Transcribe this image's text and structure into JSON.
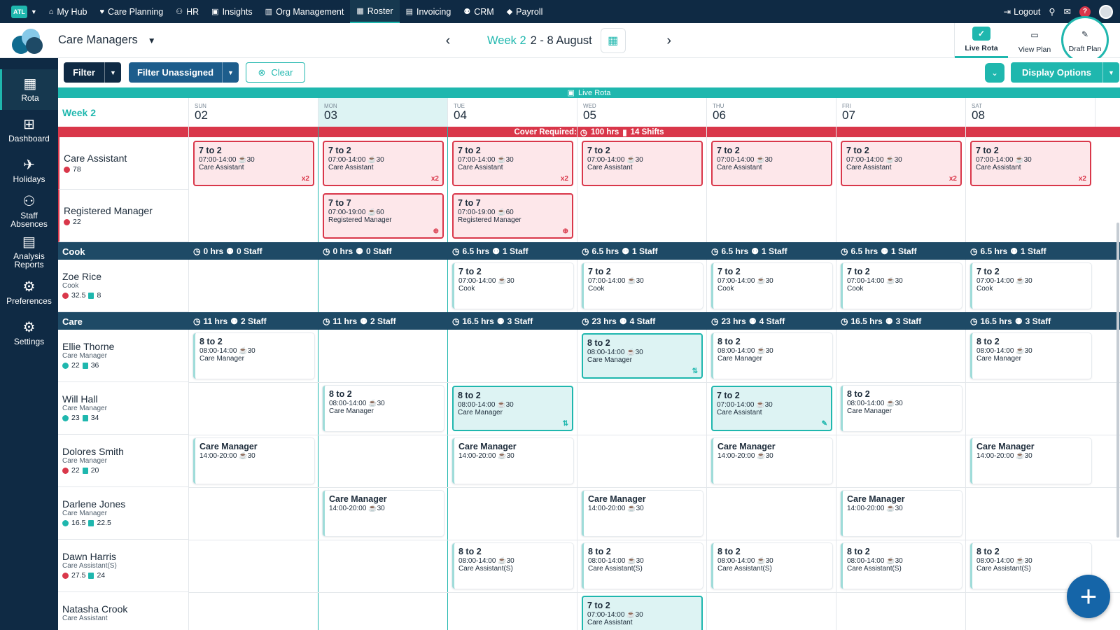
{
  "topnav": {
    "org_badge": "ATL",
    "items": [
      {
        "icon": "home-icon",
        "glyph": "⌂",
        "label": "My Hub"
      },
      {
        "icon": "heart-icon",
        "glyph": "♥",
        "label": "Care Planning"
      },
      {
        "icon": "people-icon",
        "glyph": "⚇",
        "label": "HR"
      },
      {
        "icon": "chart-icon",
        "glyph": "▣",
        "label": "Insights"
      },
      {
        "icon": "building-icon",
        "glyph": "▥",
        "label": "Org Management"
      },
      {
        "icon": "calendar-icon",
        "glyph": "▦",
        "label": "Roster"
      },
      {
        "icon": "document-icon",
        "glyph": "▤",
        "label": "Invoicing"
      },
      {
        "icon": "contacts-icon",
        "glyph": "⚉",
        "label": "CRM"
      },
      {
        "icon": "tag-icon",
        "glyph": "◆",
        "label": "Payroll"
      }
    ],
    "active": "Roster",
    "logout": "Logout",
    "help": "?"
  },
  "header": {
    "page_select": "Care Managers",
    "week_label": "Week 2",
    "week_range": "2 - 8 August",
    "tabs": [
      "Live Rota",
      "View Plan",
      "Draft Plan"
    ]
  },
  "sidebar": [
    {
      "label": "Rota",
      "icon": "rota-icon",
      "glyph": "▦"
    },
    {
      "label": "Dashboard",
      "icon": "dashboard-icon",
      "glyph": "⊞"
    },
    {
      "label": "Holidays",
      "icon": "holidays-icon",
      "glyph": "✈"
    },
    {
      "label": "Staff Absences",
      "icon": "staff-absences-icon",
      "glyph": "⚇"
    },
    {
      "label": "Analysis Reports",
      "icon": "analysis-reports-icon",
      "glyph": "▤"
    },
    {
      "label": "Preferences",
      "icon": "preferences-icon",
      "glyph": "⚙"
    },
    {
      "label": "Settings",
      "icon": "settings-icon",
      "glyph": "⚙"
    }
  ],
  "filters": {
    "filter": "Filter",
    "filter_unassigned": "Filter Unassigned",
    "clear": "Clear",
    "display_options": "Display Options"
  },
  "banner": "Live Rota",
  "week_title": "Week 2",
  "days": [
    {
      "dow": "SUN",
      "date": "02"
    },
    {
      "dow": "MON",
      "date": "03"
    },
    {
      "dow": "TUE",
      "date": "04"
    },
    {
      "dow": "WED",
      "date": "05"
    },
    {
      "dow": "THU",
      "date": "06"
    },
    {
      "dow": "FRI",
      "date": "07"
    },
    {
      "dow": "SAT",
      "date": "08"
    }
  ],
  "cover": {
    "label": "Cover Required:",
    "hours": "100 hrs",
    "shifts": "14 Shifts"
  },
  "cover_rows": [
    {
      "name": "Care Assistant",
      "count": "78",
      "shifts": [
        {
          "title": "7 to 2",
          "hours": "07:00-14:00",
          "brk": "30",
          "role": "Care Assistant",
          "corner": "x2"
        },
        {
          "title": "7 to 2",
          "hours": "07:00-14:00",
          "brk": "30",
          "role": "Care Assistant",
          "corner": "x2"
        },
        {
          "title": "7 to 2",
          "hours": "07:00-14:00",
          "brk": "30",
          "role": "Care Assistant",
          "corner": "x2"
        },
        {
          "title": "7 to 2",
          "hours": "07:00-14:00",
          "brk": "30",
          "role": "Care Assistant",
          "corner": ""
        },
        {
          "title": "7 to 2",
          "hours": "07:00-14:00",
          "brk": "30",
          "role": "Care Assistant",
          "corner": ""
        },
        {
          "title": "7 to 2",
          "hours": "07:00-14:00",
          "brk": "30",
          "role": "Care Assistant",
          "corner": "x2"
        },
        {
          "title": "7 to 2",
          "hours": "07:00-14:00",
          "brk": "30",
          "role": "Care Assistant",
          "corner": "x2"
        }
      ]
    },
    {
      "name": "Registered Manager",
      "count": "22",
      "shifts": [
        null,
        {
          "title": "7 to 7",
          "hours": "07:00-19:00",
          "brk": "60",
          "role": "Registered Manager",
          "corner": "⊕"
        },
        {
          "title": "7 to 7",
          "hours": "07:00-19:00",
          "brk": "60",
          "role": "Registered Manager",
          "corner": "⊕"
        },
        null,
        null,
        null,
        null
      ]
    }
  ],
  "sections": [
    {
      "name": "Cook",
      "stats": [
        {
          "hrs": "0 hrs",
          "staff": "0 Staff"
        },
        {
          "hrs": "0 hrs",
          "staff": "0 Staff"
        },
        {
          "hrs": "6.5 hrs",
          "staff": "1 Staff"
        },
        {
          "hrs": "6.5 hrs",
          "staff": "1 Staff"
        },
        {
          "hrs": "6.5 hrs",
          "staff": "1 Staff"
        },
        {
          "hrs": "6.5 hrs",
          "staff": "1 Staff"
        },
        {
          "hrs": "6.5 hrs",
          "staff": "1 Staff"
        }
      ],
      "staff": [
        {
          "name": "Zoe Rice",
          "role": "Cook",
          "stat1": "32.5",
          "stat1_color": "red",
          "stat2": "8",
          "shifts": [
            null,
            null,
            {
              "title": "7 to 2",
              "hours": "07:00-14:00",
              "brk": "30",
              "role": "Cook"
            },
            {
              "title": "7 to 2",
              "hours": "07:00-14:00",
              "brk": "30",
              "role": "Cook"
            },
            {
              "title": "7 to 2",
              "hours": "07:00-14:00",
              "brk": "30",
              "role": "Cook"
            },
            {
              "title": "7 to 2",
              "hours": "07:00-14:00",
              "brk": "30",
              "role": "Cook"
            },
            {
              "title": "7 to 2",
              "hours": "07:00-14:00",
              "brk": "30",
              "role": "Cook"
            }
          ]
        }
      ]
    },
    {
      "name": "Care",
      "stats": [
        {
          "hrs": "11 hrs",
          "staff": "2 Staff"
        },
        {
          "hrs": "11 hrs",
          "staff": "2 Staff"
        },
        {
          "hrs": "16.5 hrs",
          "staff": "3 Staff"
        },
        {
          "hrs": "23 hrs",
          "staff": "4 Staff"
        },
        {
          "hrs": "23 hrs",
          "staff": "4 Staff"
        },
        {
          "hrs": "16.5 hrs",
          "staff": "3 Staff"
        },
        {
          "hrs": "16.5 hrs",
          "staff": "3 Staff"
        }
      ],
      "staff": [
        {
          "name": "Ellie Thorne",
          "role": "Care Manager",
          "stat1": "22",
          "stat1_color": "teal",
          "stat2": "36",
          "shifts": [
            {
              "title": "8 to 2",
              "hours": "08:00-14:00",
              "brk": "30",
              "role": "Care Manager"
            },
            null,
            null,
            {
              "title": "8 to 2",
              "hours": "08:00-14:00",
              "brk": "30",
              "role": "Care Manager",
              "selected": true,
              "corner": "⇅"
            },
            {
              "title": "8 to 2",
              "hours": "08:00-14:00",
              "brk": "30",
              "role": "Care Manager"
            },
            null,
            {
              "title": "8 to 2",
              "hours": "08:00-14:00",
              "brk": "30",
              "role": "Care Manager"
            }
          ]
        },
        {
          "name": "Will Hall",
          "role": "Care Manager",
          "stat1": "23",
          "stat1_color": "teal",
          "stat2": "34",
          "shifts": [
            null,
            {
              "title": "8 to 2",
              "hours": "08:00-14:00",
              "brk": "30",
              "role": "Care Manager"
            },
            {
              "title": "8 to 2",
              "hours": "08:00-14:00",
              "brk": "30",
              "role": "Care Manager",
              "selected": true,
              "corner": "⇅"
            },
            null,
            {
              "title": "7 to 2",
              "hours": "07:00-14:00",
              "brk": "30",
              "role": "Care Assistant",
              "selected": true,
              "corner": "✎"
            },
            {
              "title": "8 to 2",
              "hours": "08:00-14:00",
              "brk": "30",
              "role": "Care Manager"
            },
            null
          ]
        },
        {
          "name": "Dolores Smith",
          "role": "Care Manager",
          "stat1": "22",
          "stat1_color": "red",
          "stat2": "20",
          "shifts": [
            {
              "title": "Care Manager",
              "hours": "14:00-20:00",
              "brk": "30",
              "role": ""
            },
            null,
            {
              "title": "Care Manager",
              "hours": "14:00-20:00",
              "brk": "30",
              "role": ""
            },
            null,
            {
              "title": "Care Manager",
              "hours": "14:00-20:00",
              "brk": "30",
              "role": ""
            },
            null,
            {
              "title": "Care Manager",
              "hours": "14:00-20:00",
              "brk": "30",
              "role": ""
            }
          ]
        },
        {
          "name": "Darlene Jones",
          "role": "Care Manager",
          "stat1": "16.5",
          "stat1_color": "teal",
          "stat2": "22.5",
          "shifts": [
            null,
            {
              "title": "Care Manager",
              "hours": "14:00-20:00",
              "brk": "30",
              "role": ""
            },
            null,
            {
              "title": "Care Manager",
              "hours": "14:00-20:00",
              "brk": "30",
              "role": ""
            },
            null,
            {
              "title": "Care Manager",
              "hours": "14:00-20:00",
              "brk": "30",
              "role": ""
            },
            null
          ]
        },
        {
          "name": "Dawn Harris",
          "role": "Care Assistant(S)",
          "stat1": "27.5",
          "stat1_color": "red",
          "stat2": "24",
          "shifts": [
            null,
            null,
            {
              "title": "8 to 2",
              "hours": "08:00-14:00",
              "brk": "30",
              "role": "Care Assistant(S)"
            },
            {
              "title": "8 to 2",
              "hours": "08:00-14:00",
              "brk": "30",
              "role": "Care Assistant(S)"
            },
            {
              "title": "8 to 2",
              "hours": "08:00-14:00",
              "brk": "30",
              "role": "Care Assistant(S)"
            },
            {
              "title": "8 to 2",
              "hours": "08:00-14:00",
              "brk": "30",
              "role": "Care Assistant(S)"
            },
            {
              "title": "8 to 2",
              "hours": "08:00-14:00",
              "brk": "30",
              "role": "Care Assistant(S)"
            }
          ]
        },
        {
          "name": "Natasha Crook",
          "role": "Care Assistant",
          "stat1": "",
          "stat1_color": "teal",
          "stat2": "",
          "shifts": [
            null,
            null,
            null,
            {
              "title": "7 to 2",
              "hours": "07:00-14:00",
              "brk": "30",
              "role": "Care Assistant",
              "selected": true
            },
            null,
            null,
            null
          ]
        }
      ]
    }
  ],
  "colors": {
    "accent": "#1fb7ae",
    "navy": "#0f2a44",
    "section": "#1e4a66",
    "cover_red": "#d9374a",
    "fab": "#1565a8"
  }
}
